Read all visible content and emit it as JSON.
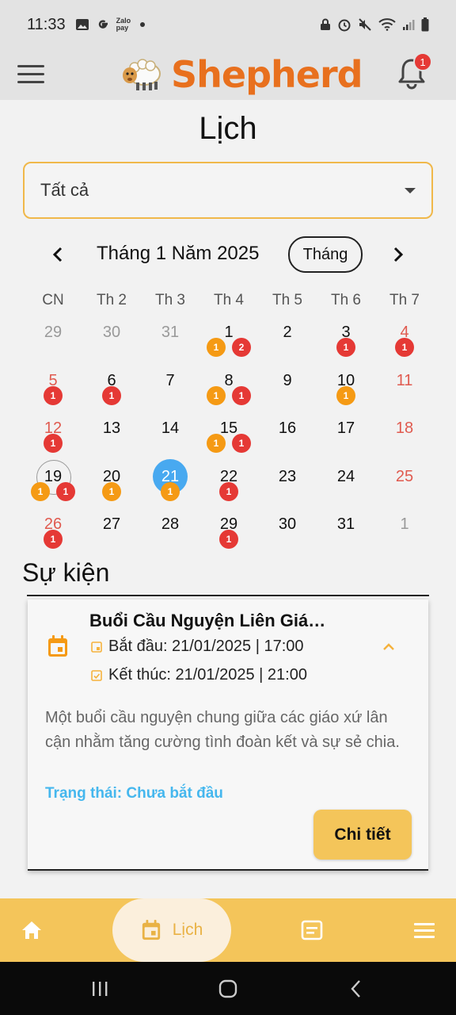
{
  "status_bar": {
    "time": "11:33",
    "left_icons": [
      "image-icon",
      "g-icon",
      "zalopay-icon",
      "dot-icon"
    ],
    "right_icons": [
      "lock-icon",
      "alarm-icon",
      "mute-icon",
      "wifi-icon",
      "signal-icon",
      "battery-icon"
    ],
    "zalo_label": "Zalo pay"
  },
  "app_bar": {
    "title": "Shepherd",
    "notification_count": "1",
    "brand_color": "#e8701e"
  },
  "page": {
    "title": "Lịch"
  },
  "filter": {
    "value": "Tất cả",
    "accent": "#f0b84a"
  },
  "calendar": {
    "month_label": "Tháng 1 Năm 2025",
    "view_mode": "Tháng",
    "weekdays": [
      "CN",
      "Th 2",
      "Th 3",
      "Th 4",
      "Th 5",
      "Th 6",
      "Th 7"
    ],
    "weeks": [
      [
        {
          "d": "29",
          "outside": true
        },
        {
          "d": "30",
          "outside": true
        },
        {
          "d": "31",
          "outside": true
        },
        {
          "d": "1",
          "markers": [
            {
              "c": "orange",
              "n": "1"
            },
            {
              "c": "red",
              "n": "2"
            }
          ]
        },
        {
          "d": "2"
        },
        {
          "d": "3",
          "markers": [
            {
              "c": "red",
              "n": "1"
            }
          ]
        },
        {
          "d": "4",
          "weekend": true,
          "markers": [
            {
              "c": "red",
              "n": "1"
            }
          ]
        }
      ],
      [
        {
          "d": "5",
          "weekend": true,
          "markers": [
            {
              "c": "red",
              "n": "1"
            }
          ]
        },
        {
          "d": "6",
          "markers": [
            {
              "c": "red",
              "n": "1"
            }
          ]
        },
        {
          "d": "7"
        },
        {
          "d": "8",
          "markers": [
            {
              "c": "orange",
              "n": "1"
            },
            {
              "c": "red",
              "n": "1"
            }
          ]
        },
        {
          "d": "9"
        },
        {
          "d": "10",
          "markers": [
            {
              "c": "orange",
              "n": "1"
            }
          ]
        },
        {
          "d": "11",
          "weekend": true
        }
      ],
      [
        {
          "d": "12",
          "weekend": true,
          "markers": [
            {
              "c": "red",
              "n": "1"
            }
          ]
        },
        {
          "d": "13"
        },
        {
          "d": "14"
        },
        {
          "d": "15",
          "markers": [
            {
              "c": "orange",
              "n": "1"
            },
            {
              "c": "red",
              "n": "1"
            }
          ]
        },
        {
          "d": "16"
        },
        {
          "d": "17"
        },
        {
          "d": "18",
          "weekend": true
        }
      ],
      [
        {
          "d": "19",
          "today": true,
          "markers": [
            {
              "c": "orange",
              "n": "1"
            },
            {
              "c": "red",
              "n": "1"
            }
          ]
        },
        {
          "d": "20",
          "markers": [
            {
              "c": "orange",
              "n": "1"
            }
          ]
        },
        {
          "d": "21",
          "selected": true,
          "markers": [
            {
              "c": "orange",
              "n": "1"
            }
          ]
        },
        {
          "d": "22",
          "markers": [
            {
              "c": "red",
              "n": "1"
            }
          ]
        },
        {
          "d": "23"
        },
        {
          "d": "24"
        },
        {
          "d": "25",
          "weekend": true
        }
      ],
      [
        {
          "d": "26",
          "weekend": true,
          "markers": [
            {
              "c": "red",
              "n": "1"
            }
          ]
        },
        {
          "d": "27"
        },
        {
          "d": "28"
        },
        {
          "d": "29",
          "markers": [
            {
              "c": "red",
              "n": "1"
            }
          ]
        },
        {
          "d": "30"
        },
        {
          "d": "31"
        },
        {
          "d": "1",
          "outside": true
        }
      ]
    ]
  },
  "events": {
    "section_title": "Sự kiện",
    "items": [
      {
        "title": "Buổi Cầu Nguyện Liên Giá…",
        "start": "Bắt đầu: 21/01/2025 | 17:00",
        "end": "Kết thúc: 21/01/2025 | 21:00",
        "description": "Một buổi cầu nguyện chung giữa các giáo xứ lân cận nhằm tăng cường tình đoàn kết và sự sẻ chia.",
        "status": "Trạng thái: Chưa bắt đầu",
        "detail_label": "Chi tiết"
      }
    ]
  },
  "bottom_nav": {
    "items": [
      {
        "icon": "home-icon",
        "label": ""
      },
      {
        "icon": "calendar-icon",
        "label": "Lịch",
        "active": true
      },
      {
        "icon": "list-icon",
        "label": ""
      },
      {
        "icon": "menu-icon",
        "label": ""
      }
    ],
    "active_label": "Lịch",
    "bar_color": "#f4c55a"
  }
}
